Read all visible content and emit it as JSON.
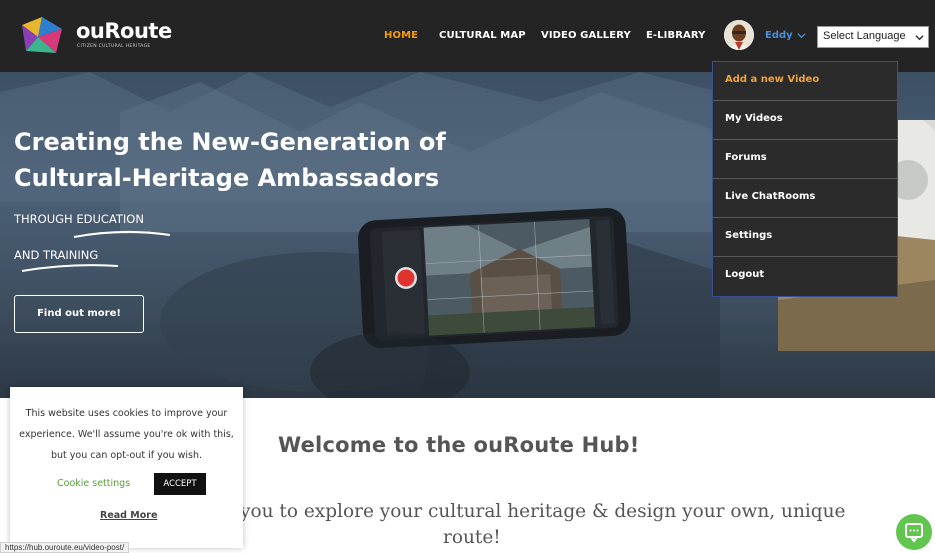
{
  "brand": {
    "name": "ouRoute",
    "subtitle": "CITIZEN CULTURAL HERITAGE"
  },
  "nav": {
    "items": [
      {
        "label": "HOME",
        "active": true
      },
      {
        "label": "CULTURAL MAP",
        "active": false
      },
      {
        "label": "VIDEO GALLERY",
        "active": false
      },
      {
        "label": "E-LIBRARY",
        "active": false
      }
    ],
    "user": "Eddy",
    "language_select": "Select Language"
  },
  "user_menu": {
    "items": [
      {
        "label": "Add a new Video",
        "active": true
      },
      {
        "label": "My Videos",
        "active": false
      },
      {
        "label": "Forums",
        "active": false
      },
      {
        "label": "Live ChatRooms",
        "active": false
      },
      {
        "label": "Settings",
        "active": false
      },
      {
        "label": "Logout",
        "active": false
      }
    ]
  },
  "hero": {
    "title_line1": "Creating the New-Generation of",
    "title_line2": "Cultural-Heritage Ambassadors",
    "sub_line1": "THROUGH EDUCATION",
    "sub_line2": "AND TRAINING",
    "cta": "Find out more!"
  },
  "content": {
    "welcome": "Welcome to the ouRoute Hub!",
    "tagline_line1": "you to explore your cultural heritage & design your own, unique",
    "tagline_line2": "route!"
  },
  "cookie": {
    "text": "This website uses cookies to improve your experience. We'll assume you're ok with this, but you can opt-out if you wish.",
    "settings": "Cookie settings",
    "accept": "ACCEPT",
    "read_more": "Read More"
  },
  "status_url": "https://hub.ouroute.eu/video-post/",
  "colors": {
    "accent": "#f39c12",
    "header_bg": "#242424",
    "user_blue": "#4a90d9",
    "chat_green": "#62c54f"
  },
  "icons": [
    "logo-icon",
    "avatar-icon",
    "chevron-down-icon",
    "chat-icon",
    "record-icon"
  ]
}
